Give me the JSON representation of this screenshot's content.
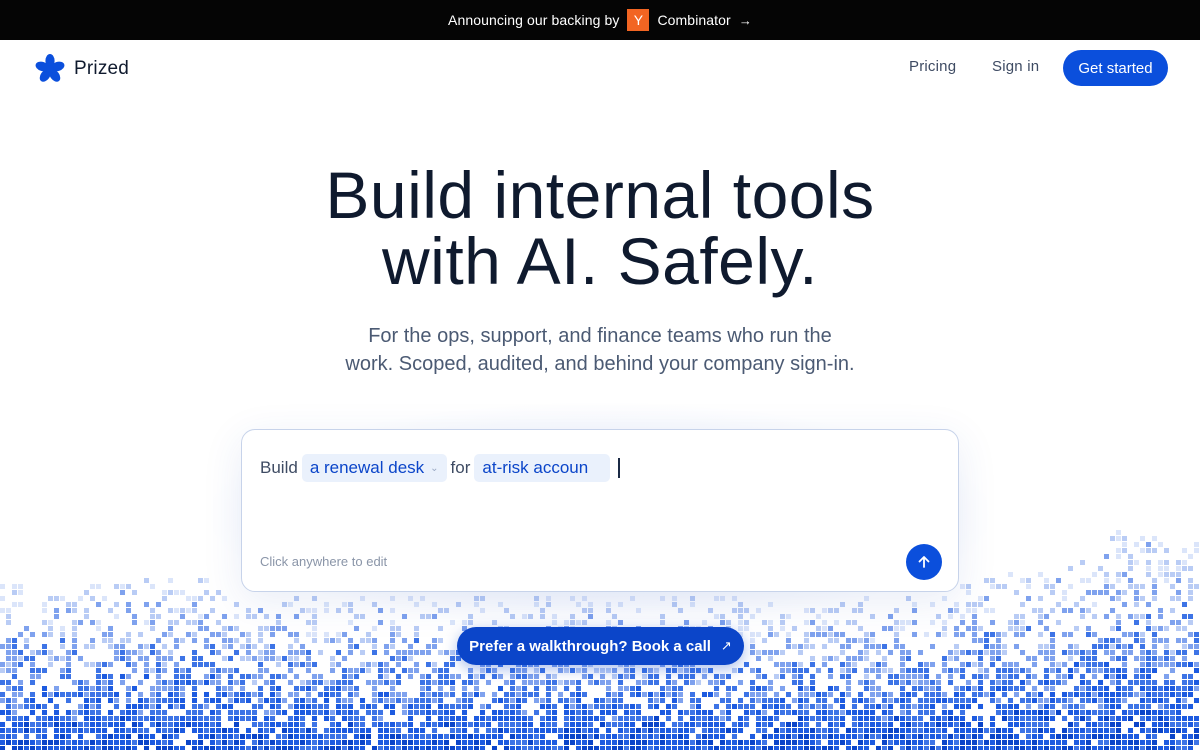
{
  "announcement": {
    "prefix": "Announcing our backing by",
    "badge": "Y",
    "suffix": "Combinator",
    "arrow": "→",
    "badge_color": "#f26522"
  },
  "header": {
    "brand": "Prized",
    "logo_icon": "asterisk-flower-icon",
    "nav": {
      "pricing": "Pricing",
      "sign_in": "Sign in",
      "cta": "Get started"
    }
  },
  "hero": {
    "title_line1": "Build internal tools",
    "title_line2": "with AI. Safely.",
    "subtitle_line1": "For the ops, support, and finance teams who run the",
    "subtitle_line2": "work. Scoped, audited, and behind your company sign-in."
  },
  "prompt": {
    "word_build": "Build",
    "select_value": "a renewal desk",
    "word_for": "for",
    "input_value": "at-risk accoun",
    "hint": "Click anywhere to edit",
    "send_icon": "arrow-up-icon"
  },
  "walkthrough": {
    "label": "Prefer a walkthrough? Book a call",
    "icon": "arrow-up-right-icon"
  },
  "colors": {
    "accent": "#0b4fdc",
    "accent_dark": "#0b45c9",
    "announce_bg": "#050505",
    "chip_bg": "#eaf1fc"
  }
}
